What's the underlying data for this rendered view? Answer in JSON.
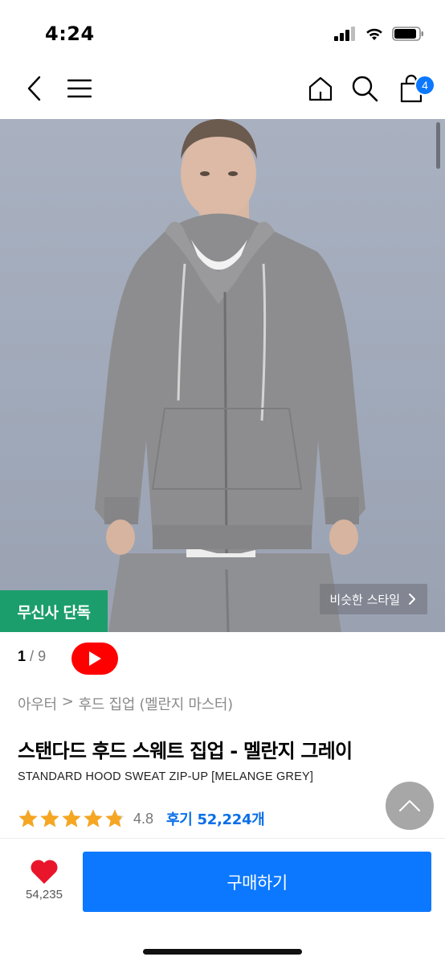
{
  "status_bar": {
    "time": "4:24"
  },
  "nav": {
    "icons": [
      "back-icon",
      "menu-icon",
      "home-icon",
      "search-icon",
      "cart-icon"
    ],
    "cart_count": "4"
  },
  "hero": {
    "exclusive_label": "무신사 단독",
    "similar_style_label": "비슷한 스타일"
  },
  "gallery": {
    "current": "1",
    "separator": "/",
    "total": "9"
  },
  "breadcrumb": {
    "category": "아우터",
    "separator": ">",
    "subcategory": "후드 집업 (멜란지 마스터)"
  },
  "product": {
    "title": "스탠다드 후드 스웨트 집업 - 멜란지 그레이",
    "subtitle": "STANDARD HOOD SWEAT ZIP-UP [MELANGE GREY]",
    "rating": "4.8",
    "rating_fraction": 0.96,
    "review_label": "후기 52,224개"
  },
  "bottom_bar": {
    "like_count": "54,235",
    "buy_label": "구매하기"
  },
  "colors": {
    "accent": "#0b78ff",
    "badge_green": "#1b9e6b",
    "star": "#f5a623",
    "youtube_red": "#ff0000",
    "like_red": "#e8152b"
  }
}
